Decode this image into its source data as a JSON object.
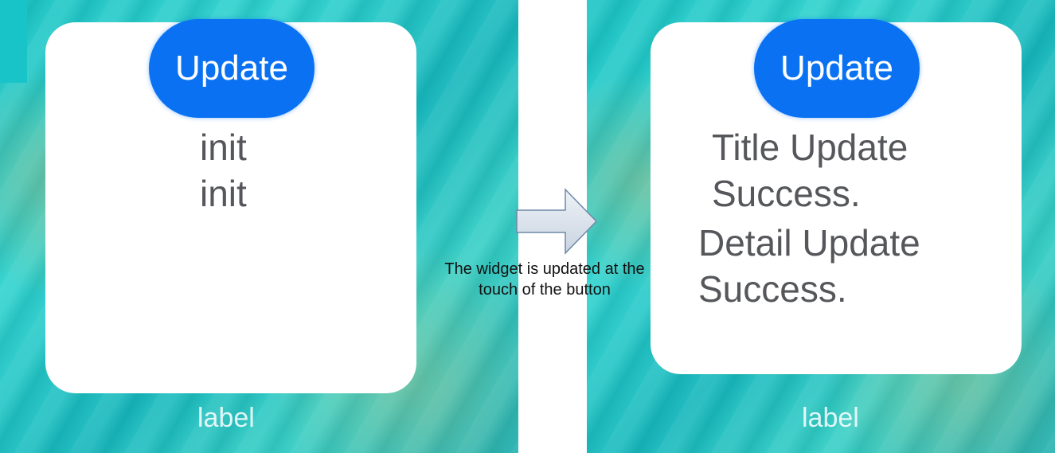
{
  "before": {
    "button_label": "Update",
    "title_text": "init",
    "detail_text": "init",
    "label": "label"
  },
  "after": {
    "button_label": "Update",
    "title_text": "Title Update Success.",
    "detail_text": "Detail Update Success.",
    "label": "label"
  },
  "caption": "The widget is updated at the touch of the button",
  "icons": [
    "right-arrow-icon"
  ],
  "colors": {
    "button": "#0a72f2",
    "card": "#ffffff",
    "wallpaper": "#1ac3c4",
    "text": "#55575b"
  }
}
